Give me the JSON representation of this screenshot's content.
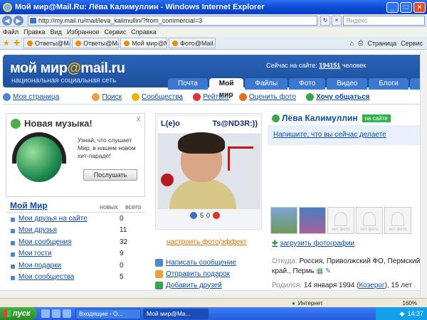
{
  "window": {
    "title": "Мой мир@Mail.Ru: Лёва Калимуллин - Windows Internet Explorer"
  },
  "browser": {
    "url": "http://my.mail.ru/mail/leva_kalimullin/?from_commercial=3",
    "search_placeholder": "Яндекс",
    "menu": [
      "Файл",
      "Правка",
      "Вид",
      "Избранное",
      "Сервис",
      "Справка"
    ],
    "tabs": [
      {
        "label": "Ответы@Mail.R..."
      },
      {
        "label": "Ответы@Mail.R..."
      },
      {
        "label": "Мой мир@Ma..."
      },
      {
        "label": "Фото@Mail.Ru:..."
      }
    ],
    "tools": {
      "page": "Страница",
      "service": "Сервис"
    }
  },
  "site": {
    "logo_main": "мой мир",
    "logo_at": "@",
    "logo_domain": "mail.ru",
    "slogan": "национальная социальная сеть",
    "online_label": "Сейчас на сайте:",
    "online_count": "194151",
    "online_suffix": "человек",
    "tabs": [
      "Почта",
      "Мой мир",
      "Файлы",
      "Фото",
      "Видео",
      "Блоги",
      "Ве"
    ],
    "subnav": [
      {
        "label": "Моя страница"
      },
      {
        "label": "Поиск"
      },
      {
        "label": "Сообщества"
      },
      {
        "label": "Рейтинг"
      },
      {
        "label": "Оценить фото"
      },
      {
        "label": "Хочу общаться"
      }
    ]
  },
  "music": {
    "title": "Новая музыка!",
    "text": "Узнай, что слушает Мир, в нашем новом хит-параде!",
    "button": "Послушать"
  },
  "my_world": {
    "title": "Мой Мир",
    "col_new": "новых",
    "col_total": "всего",
    "rows": [
      {
        "label": "Мои друзья на сайте",
        "value": "0"
      },
      {
        "label": "Мои друзья",
        "value": "11"
      },
      {
        "label": "Мои сообщения",
        "value": "32"
      },
      {
        "label": "Мои гости",
        "value": "9"
      },
      {
        "label": "Мои подарки",
        "value": "0"
      },
      {
        "label": "Мои сообщества",
        "value": "5"
      }
    ]
  },
  "profile": {
    "photo_text_left": "L(e)o",
    "photo_text_right": "Ts@ND3R:))",
    "stat_count": "5",
    "stat_zero": "0",
    "configure_photo": "настроить фото",
    "slash": "/",
    "effect": "эффект",
    "actions": [
      "Написать сообщение",
      "Отправить подарок",
      "Добавить друзей"
    ],
    "name": "Лёва Калимуллин",
    "badge": "на сайте",
    "status_prompt": "Напишите, что вы сейчас делаете",
    "no_photo": "нет фото",
    "upload": "загрузить фотографии",
    "from_label": "Откуда:",
    "from_value": "Россия, Приволжский ФО, Пермский край., Пермь",
    "born_label": "Родился:",
    "born_value": "14 января 1994",
    "zodiac": "Козерог",
    "age": "15 лет"
  },
  "statusbar": {
    "zone": "Интернет",
    "zoom": "160%"
  },
  "taskbar": {
    "start": "пуск",
    "tasks": [
      "Входящие - О...",
      "Мой мир@Ma..."
    ],
    "clock": "14:37"
  }
}
